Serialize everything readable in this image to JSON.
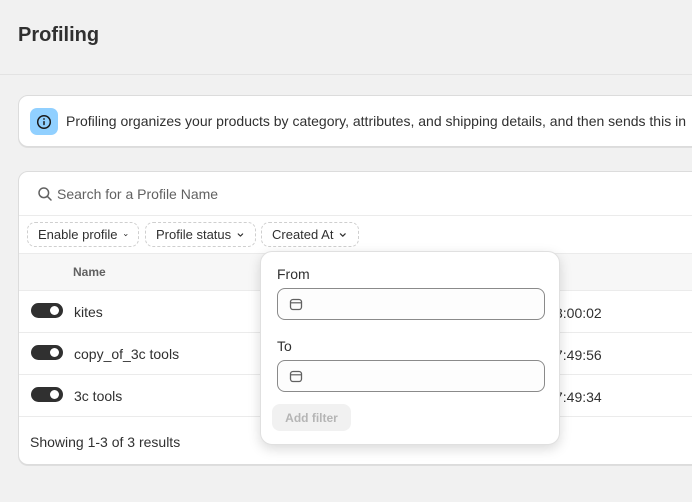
{
  "page": {
    "title": "Profiling"
  },
  "banner": {
    "icon": "info-icon",
    "text": "Profiling organizes your products by category, attributes, and shipping details, and then sends this in"
  },
  "search": {
    "placeholder": "Search for a Profile Name",
    "value": ""
  },
  "filters": [
    {
      "label": "Enable profile"
    },
    {
      "label": "Profile status"
    },
    {
      "label": "Created At"
    }
  ],
  "table": {
    "columns": {
      "name": "Name"
    },
    "rows": [
      {
        "enabled": true,
        "name": "kites",
        "date_fragment": "3:00:02"
      },
      {
        "enabled": true,
        "name": "copy_of_3c tools",
        "date_fragment": "7:49:56"
      },
      {
        "enabled": true,
        "name": "3c tools",
        "date_fragment": "7:49:34"
      }
    ]
  },
  "footer": {
    "text": "Showing 1-3 of 3 results"
  },
  "popover": {
    "from_label": "From",
    "from_value": "",
    "to_label": "To",
    "to_value": "",
    "add_filter_label": "Add filter"
  },
  "colors": {
    "info_accent": "#91d0ff",
    "toggle_on": "#303030"
  }
}
